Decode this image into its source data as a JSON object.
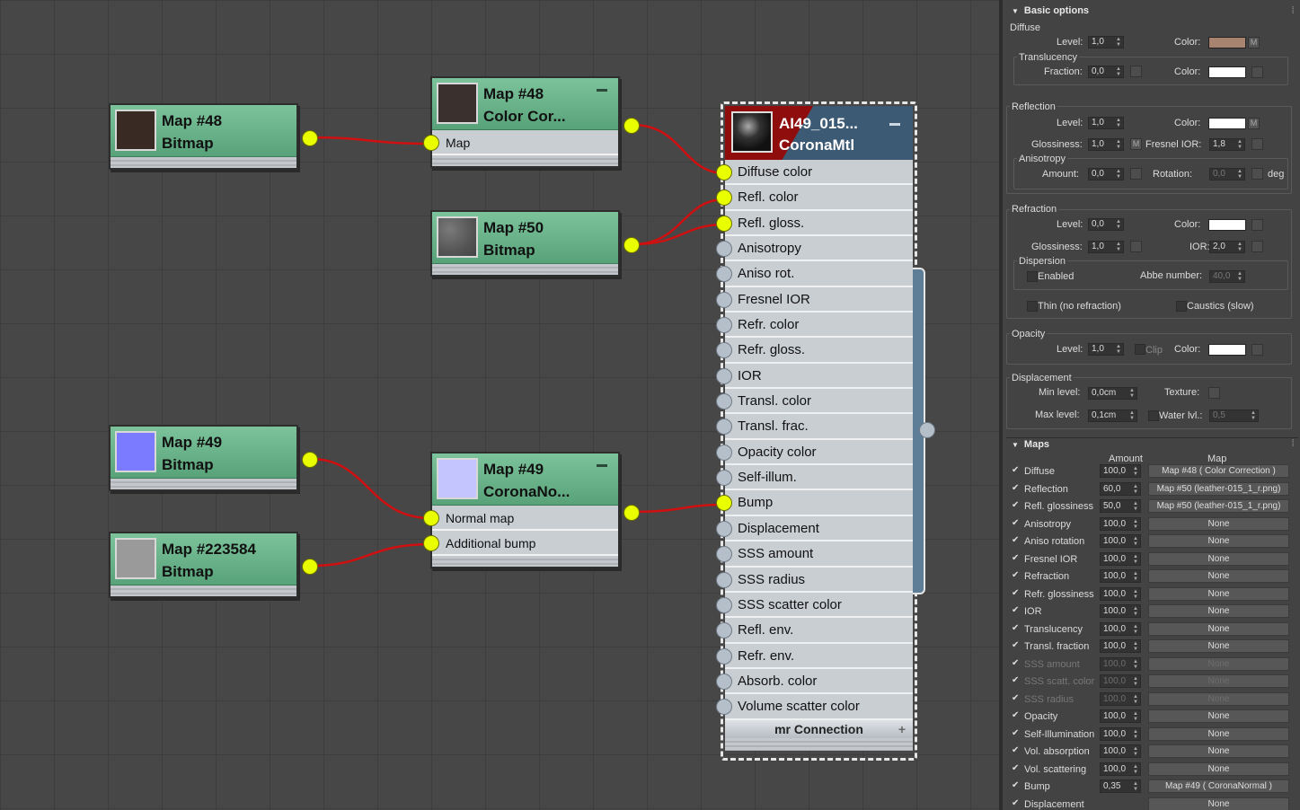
{
  "nodes": {
    "bitmap48": {
      "title": "Map #48",
      "subtitle": "Bitmap",
      "thumb": "#3a2a24"
    },
    "cc48": {
      "title": "Map #48",
      "subtitle": "Color Cor...",
      "thumb": "#3a302e",
      "slots": [
        "Map"
      ]
    },
    "bitmap50": {
      "title": "Map #50",
      "subtitle": "Bitmap",
      "thumb": "#6a6a6a"
    },
    "bitmap49": {
      "title": "Map #49",
      "subtitle": "Bitmap",
      "thumb": "#7b7bff"
    },
    "normal49": {
      "title": "Map #49",
      "subtitle": "CoronaNo...",
      "thumb": "#c4c4ff",
      "slots": [
        "Normal map",
        "Additional bump"
      ]
    },
    "bitmap223584": {
      "title": "Map #223584",
      "subtitle": "Bitmap",
      "thumb": "#9a9a9a"
    }
  },
  "material": {
    "title": "AI49_015...",
    "subtitle": "CoronaMtl",
    "slots": [
      "Diffuse color",
      "Refl. color",
      "Refl. gloss.",
      "Anisotropy",
      "Aniso rot.",
      "Fresnel IOR",
      "Refr. color",
      "Refr. gloss.",
      "IOR",
      "Transl. color",
      "Transl. frac.",
      "Opacity color",
      "Self-illum.",
      "Bump",
      "Displacement",
      "SSS amount",
      "SSS radius",
      "SSS scatter color",
      "Refl. env.",
      "Refr. env.",
      "Absorb. color",
      "Volume scatter color"
    ],
    "connected": [
      0,
      1,
      2,
      13
    ],
    "footer": "mr Connection",
    "plus": "+"
  },
  "panel": {
    "basic": {
      "header": "Basic options",
      "diffuse": {
        "label": "Diffuse",
        "level_label": "Level:",
        "level": "1,0",
        "color_label": "Color:",
        "color": "#a88470",
        "m": "M"
      },
      "translucency": {
        "label": "Translucency",
        "fraction_label": "Fraction:",
        "fraction": "0,0",
        "color_label": "Color:",
        "color": "#ffffff"
      },
      "reflection": {
        "label": "Reflection",
        "level_label": "Level:",
        "level": "1,0",
        "color_label": "Color:",
        "color": "#ffffff",
        "m": "M",
        "gloss_label": "Glossiness:",
        "gloss": "1,0",
        "gm": "M",
        "fresnel_label": "Fresnel IOR:",
        "fresnel": "1,8"
      },
      "anisotropy": {
        "label": "Anisotropy",
        "amount_label": "Amount:",
        "amount": "0,0",
        "rotation_label": "Rotation:",
        "rotation": "0,0",
        "deg": "deg"
      },
      "refraction": {
        "label": "Refraction",
        "level_label": "Level:",
        "level": "0,0",
        "color_label": "Color:",
        "color": "#ffffff",
        "gloss_label": "Glossiness:",
        "gloss": "1,0",
        "ior_label": "IOR:",
        "ior": "2,0"
      },
      "dispersion": {
        "label": "Dispersion",
        "enabled": "Enabled",
        "abbe_label": "Abbe number:",
        "abbe": "40,0"
      },
      "thin": "Thin (no refraction)",
      "caustics": "Caustics (slow)",
      "opacity": {
        "label": "Opacity",
        "level_label": "Level:",
        "level": "1,0",
        "clip": "Clip",
        "color_label": "Color:",
        "color": "#ffffff"
      },
      "displacement": {
        "label": "Displacement",
        "min_label": "Min level:",
        "min": "0,0cm",
        "max_label": "Max level:",
        "max": "0,1cm",
        "texture_label": "Texture:",
        "water_label": "Water lvl.:",
        "water": "0,5"
      }
    },
    "maps": {
      "header": "Maps",
      "amount_header": "Amount",
      "map_header": "Map",
      "rows": [
        {
          "name": "Diffuse",
          "amount": "100,0",
          "map": "Map #48  ( Color Correction )",
          "on": true
        },
        {
          "name": "Reflection",
          "amount": "60,0",
          "map": "Map #50 (leather-015_1_r.png)",
          "on": true
        },
        {
          "name": "Refl. glossiness",
          "amount": "50,0",
          "map": "Map #50 (leather-015_1_r.png)",
          "on": true
        },
        {
          "name": "Anisotropy",
          "amount": "100,0",
          "map": "None",
          "on": true
        },
        {
          "name": "Aniso rotation",
          "amount": "100,0",
          "map": "None",
          "on": true
        },
        {
          "name": "Fresnel IOR",
          "amount": "100,0",
          "map": "None",
          "on": true
        },
        {
          "name": "Refraction",
          "amount": "100,0",
          "map": "None",
          "on": true
        },
        {
          "name": "Refr. glossiness",
          "amount": "100,0",
          "map": "None",
          "on": true
        },
        {
          "name": "IOR",
          "amount": "100,0",
          "map": "None",
          "on": true
        },
        {
          "name": "Translucency",
          "amount": "100,0",
          "map": "None",
          "on": true
        },
        {
          "name": "Transl. fraction",
          "amount": "100,0",
          "map": "None",
          "on": true
        },
        {
          "name": "SSS amount",
          "amount": "100,0",
          "map": "None",
          "on": false
        },
        {
          "name": "SSS scatt. color",
          "amount": "100,0",
          "map": "None",
          "on": false
        },
        {
          "name": "SSS radius",
          "amount": "100,0",
          "map": "None",
          "on": false
        },
        {
          "name": "Opacity",
          "amount": "100,0",
          "map": "None",
          "on": true
        },
        {
          "name": "Self-Illumination",
          "amount": "100,0",
          "map": "None",
          "on": true
        },
        {
          "name": "Vol. absorption",
          "amount": "100,0",
          "map": "None",
          "on": true
        },
        {
          "name": "Vol. scattering",
          "amount": "100,0",
          "map": "None",
          "on": true
        },
        {
          "name": "Bump",
          "amount": "0,35",
          "map": "Map #49  ( CoronaNormal )",
          "on": true
        },
        {
          "name": "Displacement",
          "amount": "",
          "map": "None",
          "on": true
        }
      ]
    }
  },
  "colors": {
    "wire": "#d01010",
    "socket_on": "#e9ff00",
    "node_green": "#6bb58c"
  }
}
